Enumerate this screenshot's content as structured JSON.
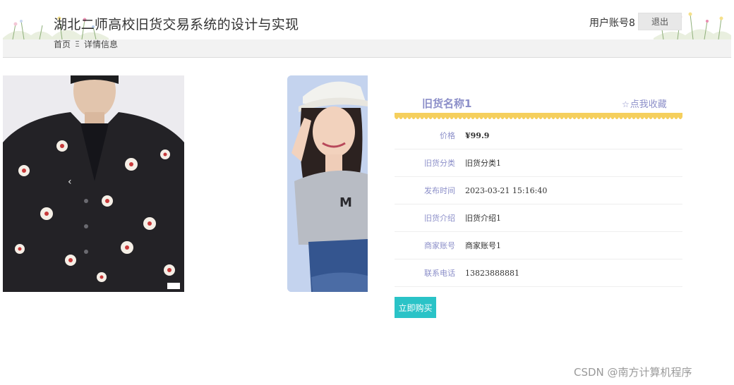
{
  "header": {
    "site_title": "湖北二师高校旧货交易系统的设计与实现",
    "user_account": "用户账号8",
    "logout_label": "退出"
  },
  "breadcrumb": {
    "home": "首页",
    "separator_icon": "menu-icon",
    "separator_glyph": "Ξ",
    "current": "详情信息"
  },
  "carousel": {
    "prev_glyph": "‹"
  },
  "item": {
    "name": "旧货名称1",
    "favorite_icon_glyph": "☆",
    "favorite_label": "点我收藏",
    "fields": [
      {
        "label": "价格",
        "value": "¥99.9"
      },
      {
        "label": "旧货分类",
        "value": "旧货分类1"
      },
      {
        "label": "发布时间",
        "value": "2023-03-21 15:16:40"
      },
      {
        "label": "旧货介绍",
        "value": "旧货介绍1"
      },
      {
        "label": "商家账号",
        "value": "商家账号1"
      },
      {
        "label": "联系电话",
        "value": "13823888881"
      }
    ],
    "buy_label": "立即购买"
  },
  "watermark": "CSDN @南方计算机程序",
  "colors": {
    "accent": "#8c8fc9",
    "buy_button": "#2ac3c7",
    "scallop": "#f5cf5d"
  }
}
